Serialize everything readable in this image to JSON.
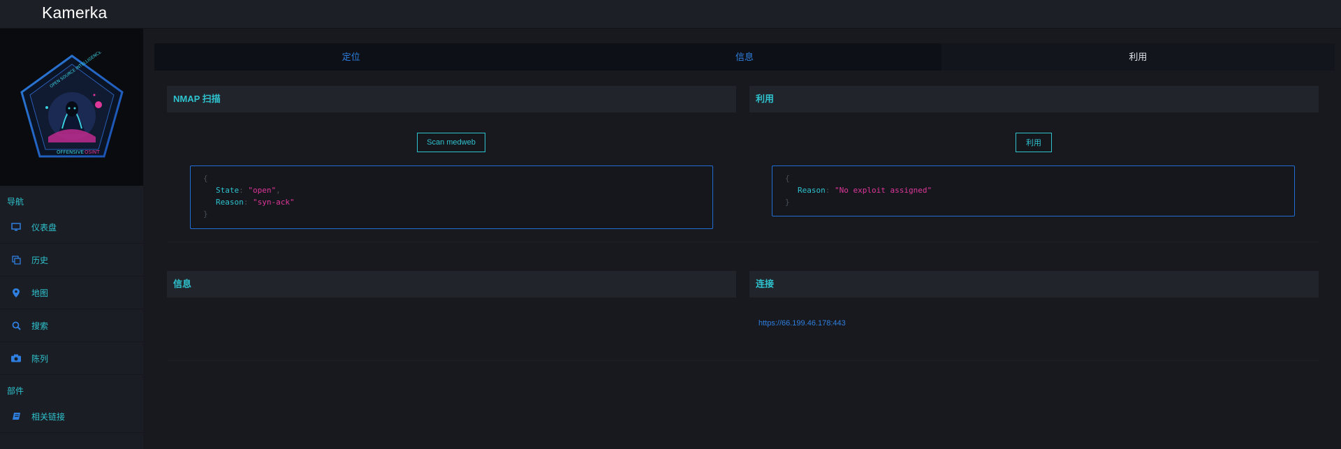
{
  "app": {
    "brand": "Kamerka"
  },
  "sidebar": {
    "logo_text": {
      "top": "OPEN SOURCE INTELLIGENCE",
      "bottom": "OFFENSIVE",
      "bottom_highlight": "OSINT"
    },
    "nav_title": "导航",
    "items": [
      {
        "label": "仪表盘",
        "icon": "monitor-icon"
      },
      {
        "label": "历史",
        "icon": "copy-icon"
      },
      {
        "label": "地图",
        "icon": "map-pin-icon"
      },
      {
        "label": "搜索",
        "icon": "search-icon"
      },
      {
        "label": "陈列",
        "icon": "camera-icon"
      }
    ],
    "parts_title": "部件",
    "parts_items": [
      {
        "label": "相关链接",
        "icon": "book-icon"
      }
    ]
  },
  "tabs": [
    {
      "label": "定位",
      "active": false
    },
    {
      "label": "信息",
      "active": false
    },
    {
      "label": "利用",
      "active": true
    }
  ],
  "nmap": {
    "title": "NMAP 扫描",
    "button": "Scan medweb",
    "result": [
      {
        "key": "State",
        "value": "\"open\""
      },
      {
        "key": "Reason",
        "value": "\"syn-ack\""
      }
    ]
  },
  "exploit": {
    "title": "利用",
    "button": "利用",
    "result": [
      {
        "key": "Reason",
        "value": "\"No exploit assigned\""
      }
    ]
  },
  "info": {
    "title": "信息"
  },
  "connect": {
    "title": "连接",
    "link": "https://66.199.46.178:443"
  },
  "colors": {
    "accent": "#2fc3cf",
    "link": "#2f7fe0",
    "value": "#e0379a",
    "border": "#1f6fd6"
  }
}
